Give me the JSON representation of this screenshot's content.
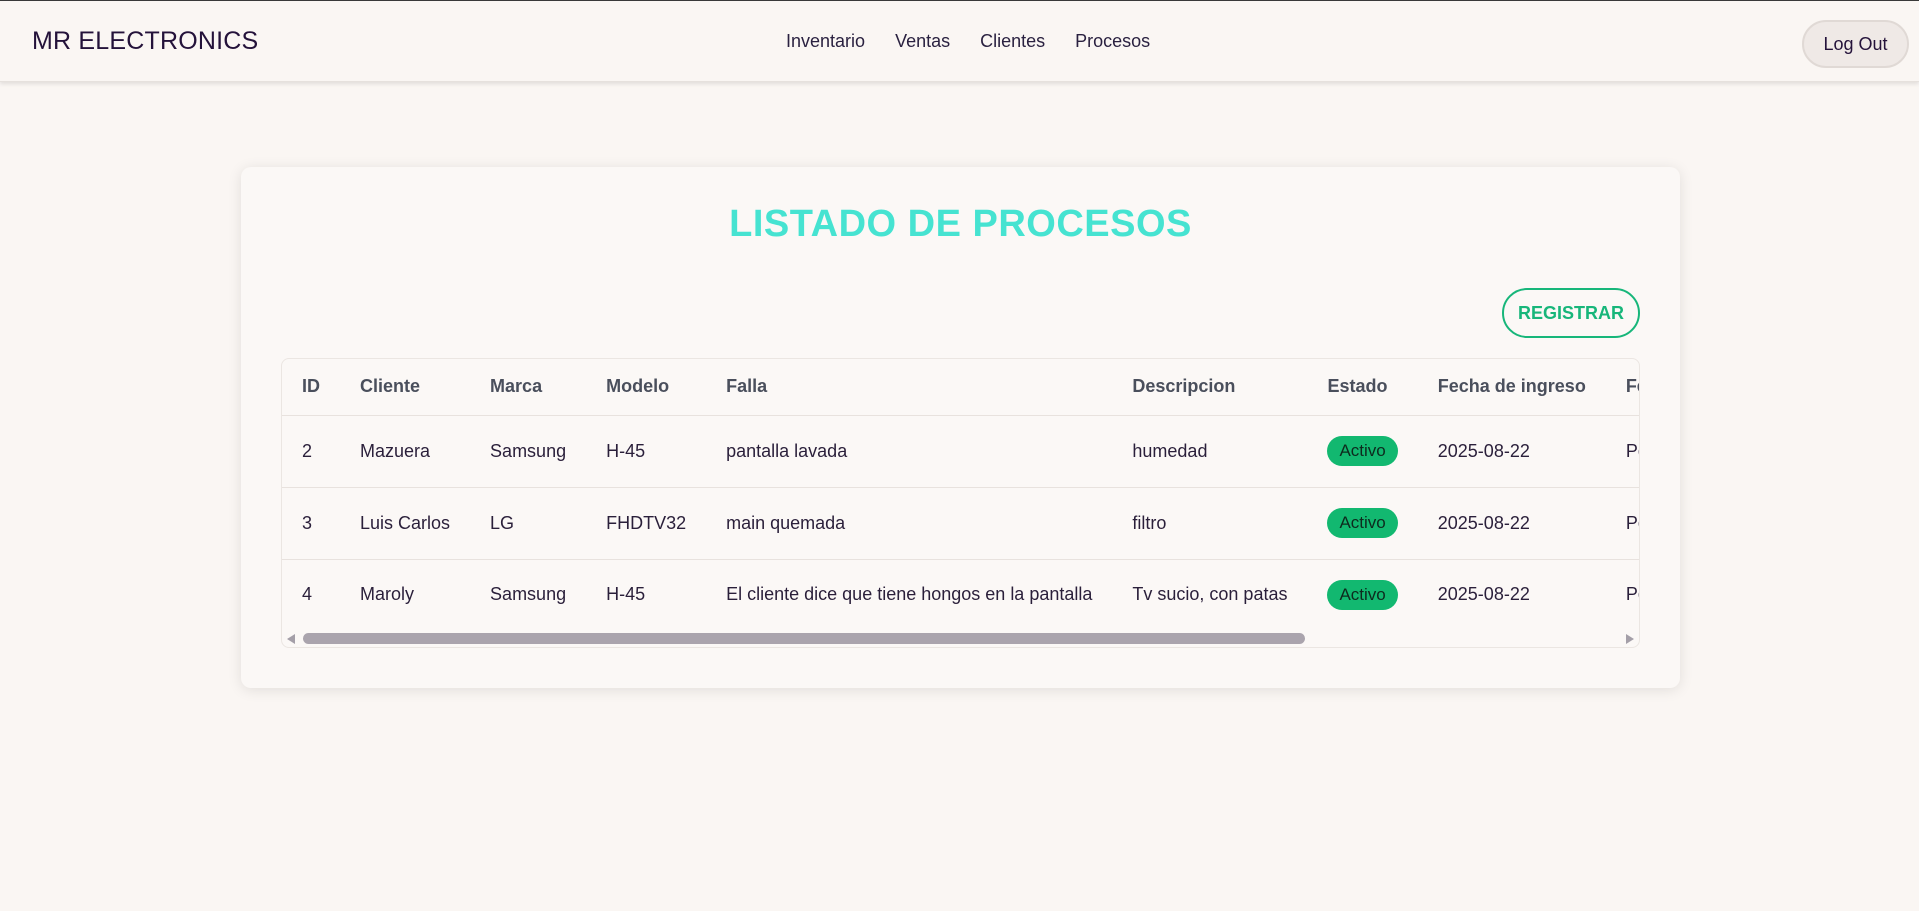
{
  "navbar": {
    "brand": "MR ELECTRONICS",
    "links": [
      "Inventario",
      "Ventas",
      "Clientes",
      "Procesos"
    ],
    "logout_label": "Log Out"
  },
  "page": {
    "title": "LISTADO DE PROCESOS",
    "register_label": "REGISTRAR"
  },
  "table": {
    "headers": [
      "ID",
      "Cliente",
      "Marca",
      "Modelo",
      "Falla",
      "Descripcion",
      "Estado",
      "Fecha de ingreso",
      "Fecha de"
    ],
    "rows": [
      [
        "2",
        "Mazuera",
        "Samsung",
        "H-45",
        "pantalla lavada",
        "humedad",
        "Activo",
        "2025-08-22",
        "Pendient"
      ],
      [
        "3",
        "Luis Carlos",
        "LG",
        "FHDTV32",
        "main quemada",
        "filtro",
        "Activo",
        "2025-08-22",
        "Pendient"
      ],
      [
        "4",
        "Maroly",
        "Samsung",
        "H-45",
        "El cliente dice que tiene hongos en la pantalla",
        "Tv sucio, con patas",
        "Activo",
        "2025-08-22",
        "Pendient"
      ]
    ]
  },
  "colors": {
    "title": "#46e3d1",
    "accent_green": "#17b67a",
    "badge": "#12b870"
  }
}
